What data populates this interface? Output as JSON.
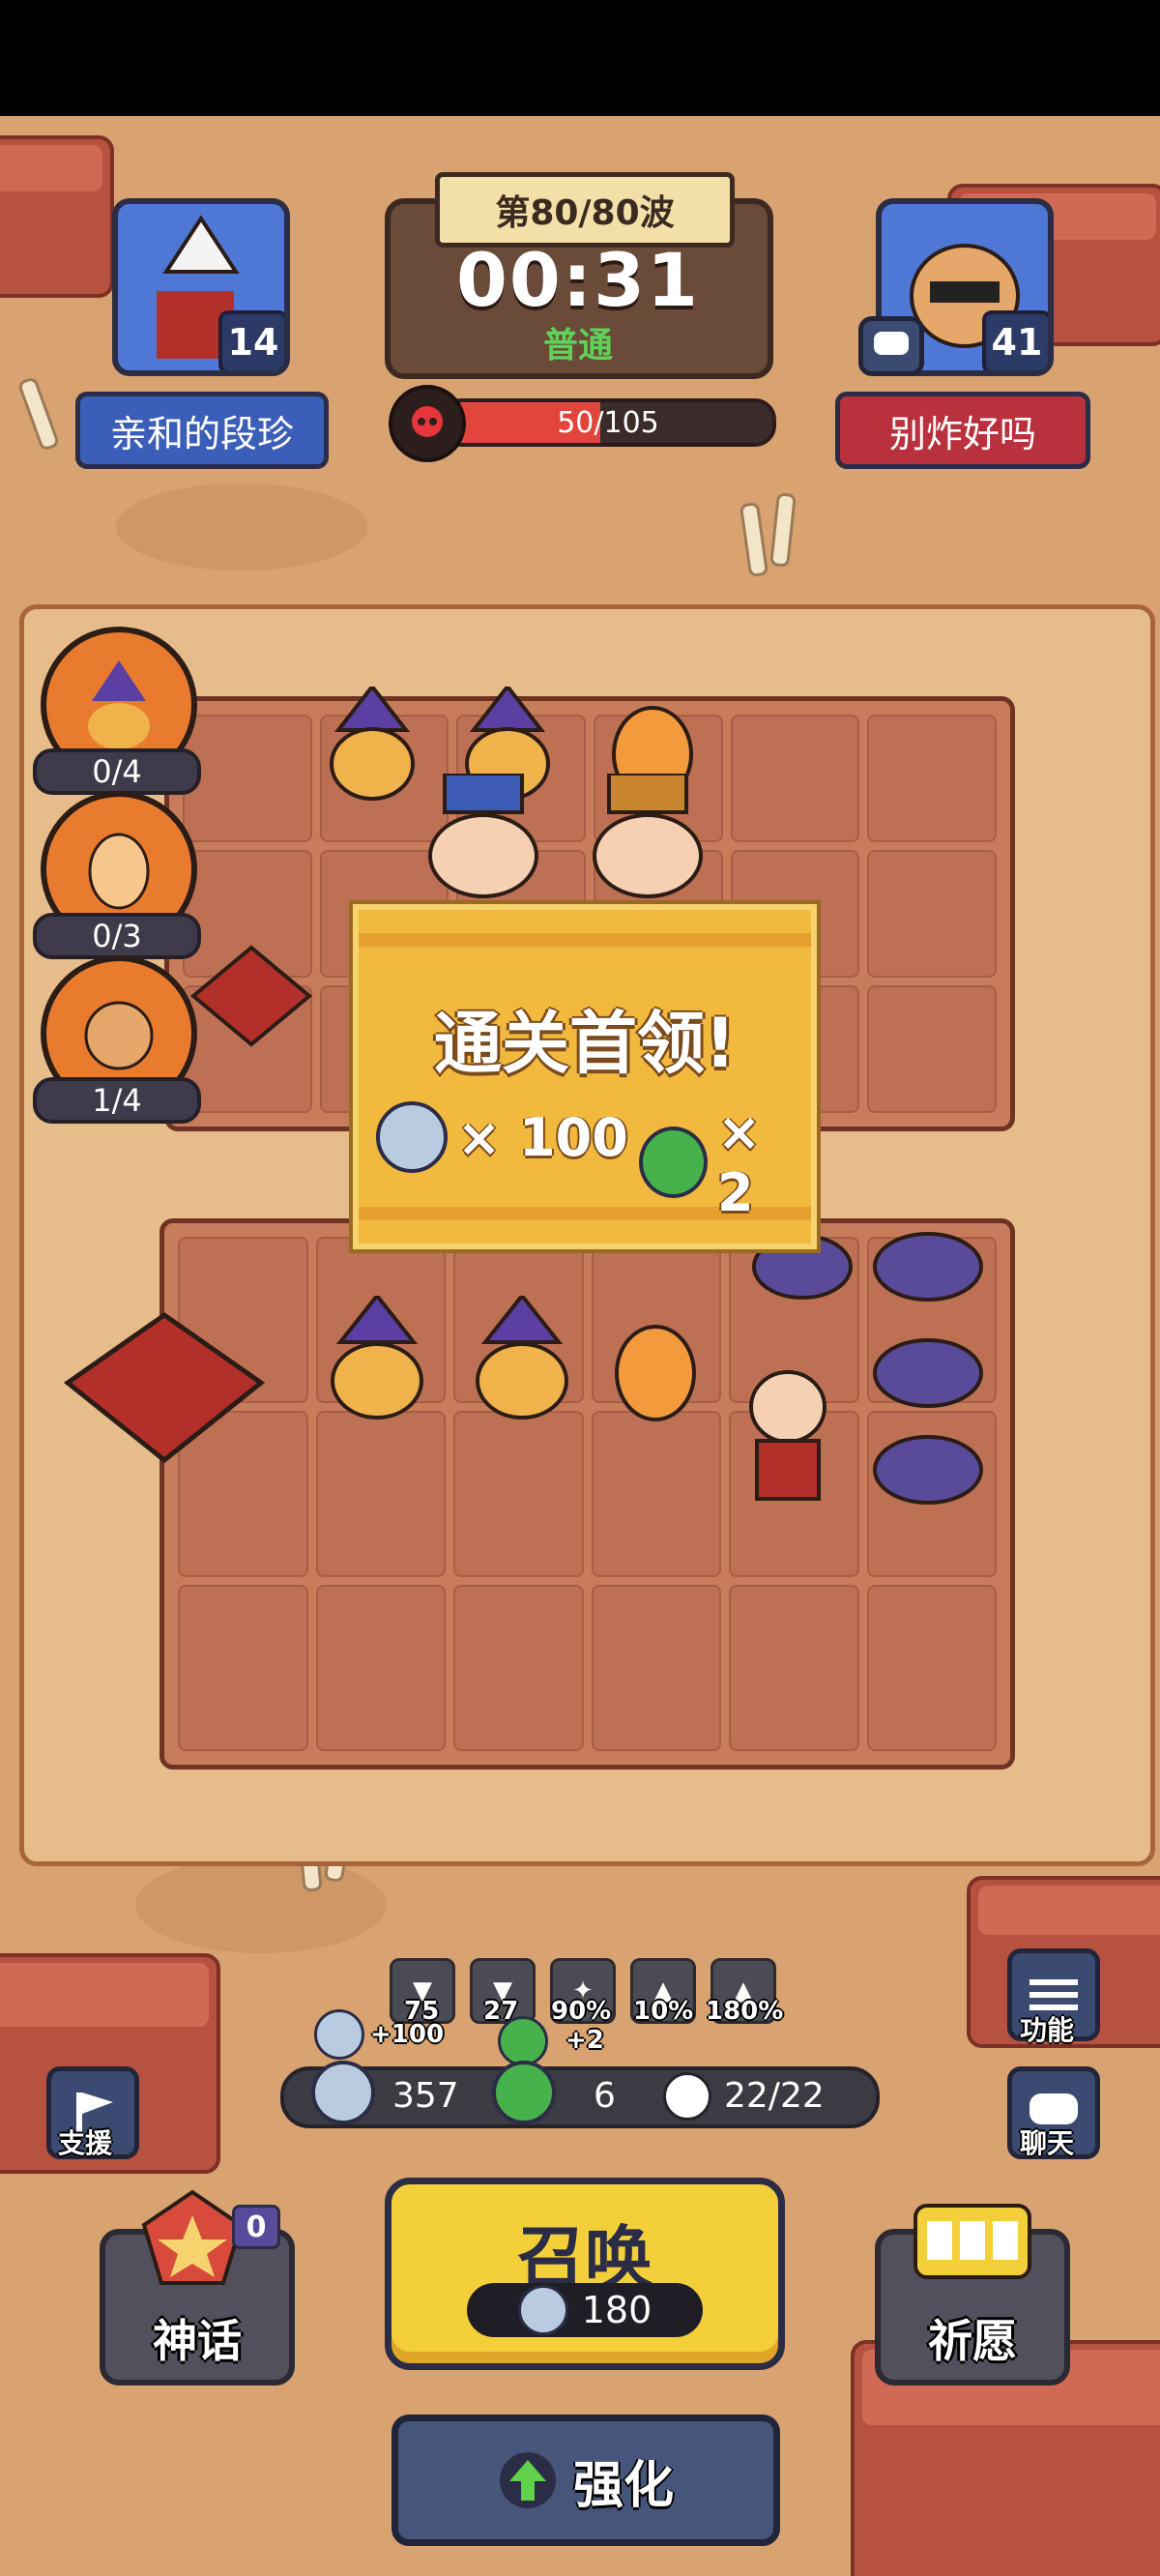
{
  "header": {
    "wave_label": "第80/80波",
    "timer": "00:31",
    "difficulty": "普通",
    "boss_hp_text": "50/105",
    "boss_hp_fraction": 0.476
  },
  "player_left": {
    "level": "14",
    "name": "亲和的段珍"
  },
  "player_right": {
    "level": "41",
    "name": "别炸好吗"
  },
  "side_slots": [
    {
      "icon": "wizard-dog-icon",
      "count": "0/4"
    },
    {
      "icon": "fire-egg-icon",
      "count": "0/3"
    },
    {
      "icon": "monkey-icon",
      "count": "1/4"
    }
  ],
  "popup": {
    "title": "通关首领!",
    "reward_silver": "× 100",
    "reward_green": "× 2"
  },
  "stats": [
    {
      "icon": "attack-down-icon",
      "value": "75"
    },
    {
      "icon": "defense-down-icon",
      "value": "27"
    },
    {
      "icon": "crit-up-icon",
      "value": "90%"
    },
    {
      "icon": "speed-up-icon",
      "value": "10%"
    },
    {
      "icon": "damage-up-icon",
      "value": "180%"
    }
  ],
  "floating_gains": {
    "silver": "+100",
    "green": "+2"
  },
  "resources": {
    "silver": "357",
    "green": "6",
    "population": "22/22"
  },
  "buttons": {
    "function": "功能",
    "chat": "聊天",
    "support": "支援",
    "myth": "神话",
    "myth_badge": "0",
    "summon": "召唤",
    "summon_cost": "180",
    "pray": "祈愿",
    "enhance": "强化"
  },
  "colors": {
    "sand": "#d9a271",
    "rock": "#b6523f",
    "summon_yellow": "#f3cf3a",
    "popup_gold": "#f2b93f",
    "hp_red": "#e2453c",
    "difficulty_green": "#61d159"
  }
}
